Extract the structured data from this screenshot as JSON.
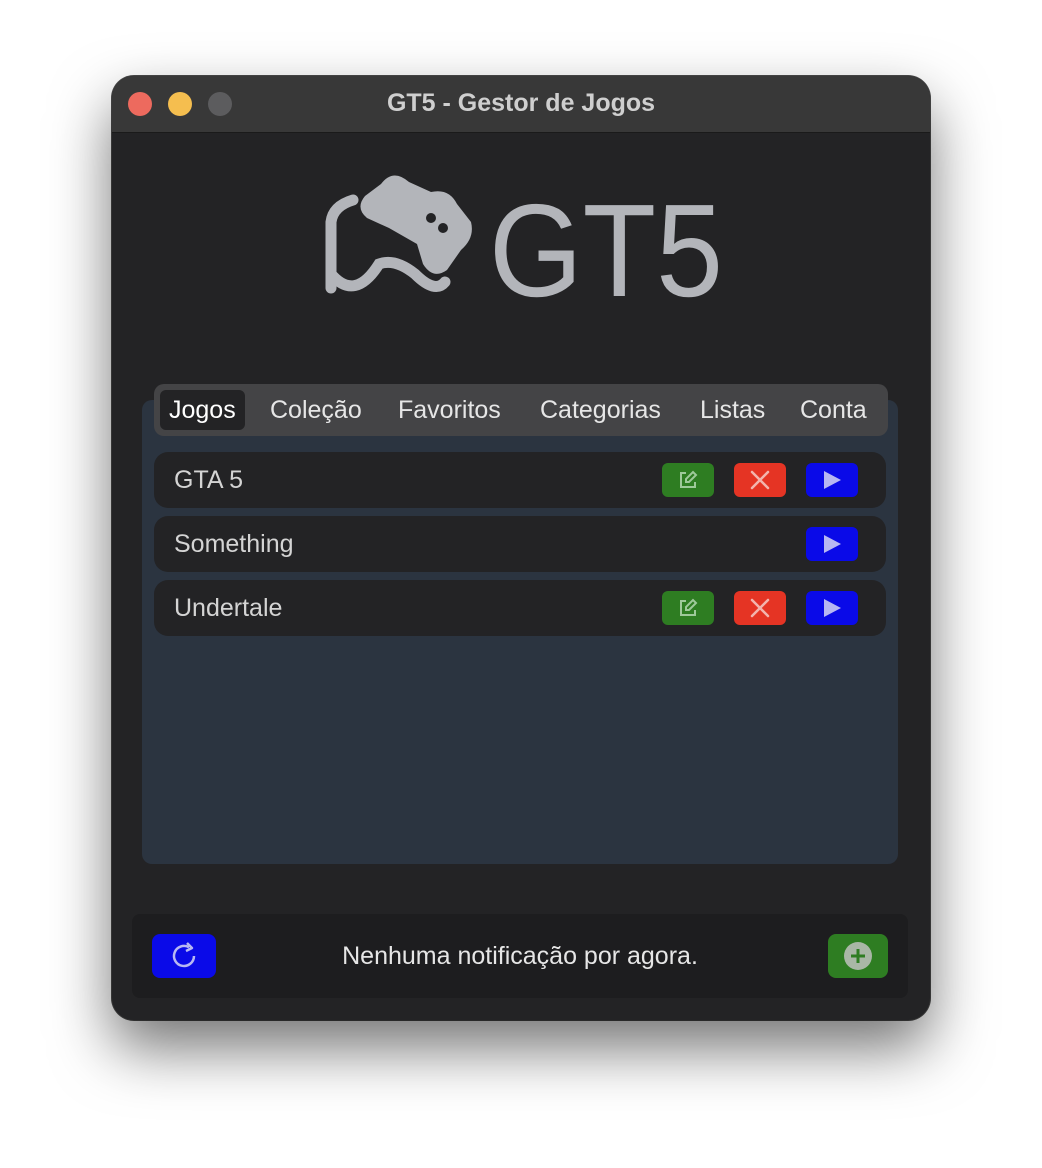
{
  "window": {
    "title": "GT5 - Gestor de Jogos"
  },
  "logo": {
    "text": "GT5",
    "icon": "gamepad-icon"
  },
  "tabs": [
    {
      "label": "Jogos",
      "active": true
    },
    {
      "label": "Coleção",
      "active": false
    },
    {
      "label": "Favoritos",
      "active": false
    },
    {
      "label": "Categorias",
      "active": false
    },
    {
      "label": "Listas",
      "active": false
    },
    {
      "label": "Conta",
      "active": false
    }
  ],
  "games": [
    {
      "name": "GTA 5",
      "actions": [
        "edit-icon",
        "delete-icon",
        "play-icon"
      ]
    },
    {
      "name": "Something",
      "actions": [
        "play-icon"
      ]
    },
    {
      "name": "Undertale",
      "actions": [
        "edit-icon",
        "delete-icon",
        "play-icon"
      ]
    }
  ],
  "footer": {
    "notification": "Nenhuma notificação por agora.",
    "refresh_icon": "refresh-icon",
    "add_icon": "plus-circle-icon"
  },
  "colors": {
    "window_bg": "#232325",
    "panel_bg": "#2b3440",
    "edit_green": "#2e7d22",
    "delete_red": "#e53424",
    "play_blue": "#0a0ae8"
  }
}
